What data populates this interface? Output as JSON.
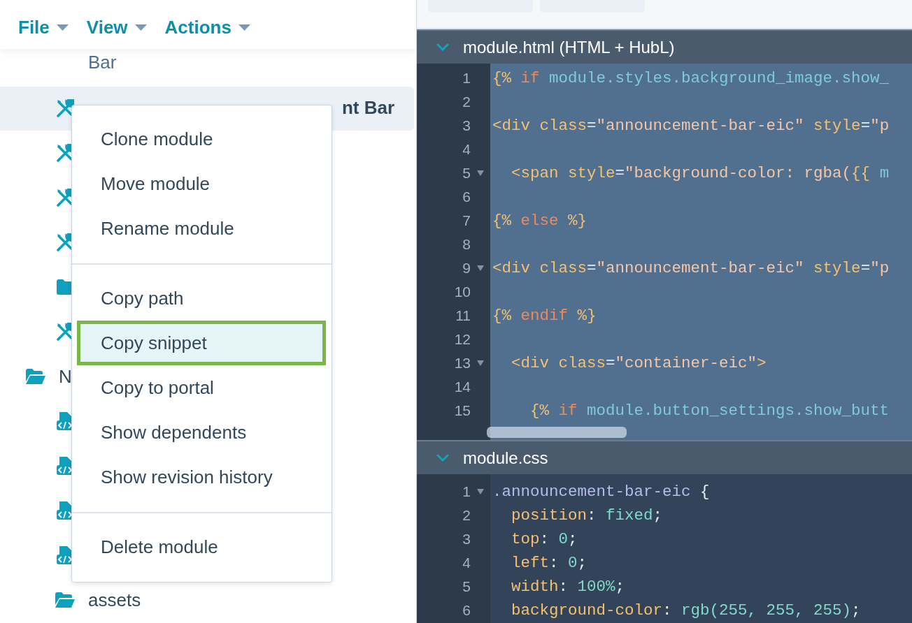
{
  "menu_bar": [
    {
      "label": "File"
    },
    {
      "label": "View"
    },
    {
      "label": "Actions"
    }
  ],
  "tree": {
    "items": [
      {
        "children": [
          {
            "kind": "continuation",
            "label": "Bar",
            "selected": false
          },
          {
            "kind": "module",
            "label": "nt Bar",
            "selected": true
          },
          {
            "kind": "module",
            "selected": false
          },
          {
            "kind": "module",
            "selected": false
          },
          {
            "kind": "module",
            "selected": false
          },
          {
            "kind": "folder",
            "expanded": false,
            "selected": false
          },
          {
            "kind": "module",
            "selected": false
          }
        ]
      },
      {
        "kind": "folder",
        "label": "N",
        "expanded": true,
        "selected": false,
        "children": [
          {
            "kind": "code",
            "selected": false
          },
          {
            "kind": "code",
            "selected": false
          },
          {
            "kind": "code",
            "selected": false
          },
          {
            "kind": "code",
            "selected": false
          },
          {
            "kind": "folder",
            "label": "assets",
            "expanded": true,
            "selected": false
          }
        ]
      }
    ]
  },
  "context_menu": {
    "sections": [
      [
        {
          "label": "Clone module",
          "selected": false
        },
        {
          "label": "Move module",
          "selected": false
        },
        {
          "label": "Rename module",
          "selected": false
        }
      ],
      [
        {
          "label": "Copy path",
          "selected": false
        },
        {
          "label": "Copy snippet",
          "selected": true
        },
        {
          "label": "Copy to portal",
          "selected": false
        },
        {
          "label": "Show dependents",
          "selected": false
        },
        {
          "label": "Show revision history",
          "selected": false
        }
      ],
      [
        {
          "label": "Delete module",
          "selected": false
        }
      ]
    ]
  },
  "editors": [
    {
      "title": "module.html (HTML + HubL)",
      "expanded": true,
      "selected_code": true,
      "lines": [
        {
          "number": "1",
          "foldable": false,
          "tokens": [
            {
              "kind": "delim",
              "text": "{%"
            },
            {
              "kind": "keyword",
              "text": " if"
            },
            {
              "kind": "ident",
              "text": " module.styles.background_image.show_"
            }
          ]
        },
        {
          "number": "2",
          "foldable": false
        },
        {
          "number": "3",
          "foldable": false,
          "tokens": [
            {
              "kind": "tag",
              "text": "<div"
            },
            {
              "kind": "attr",
              "text": " class"
            },
            {
              "kind": "punct",
              "text": "="
            },
            {
              "kind": "string",
              "text": "\"announcement-bar-eic\""
            },
            {
              "kind": "attr",
              "text": " style"
            },
            {
              "kind": "punct",
              "text": "="
            },
            {
              "kind": "string",
              "text": "\"p"
            }
          ]
        },
        {
          "number": "4",
          "foldable": false
        },
        {
          "number": "5",
          "foldable": true,
          "tokens": [
            {
              "kind": "tag",
              "text": "  <span"
            },
            {
              "kind": "attr",
              "text": " style"
            },
            {
              "kind": "punct",
              "text": "="
            },
            {
              "kind": "string",
              "text": "\"background-color: rgba("
            },
            {
              "kind": "delim",
              "text": "{{"
            },
            {
              "kind": "ident",
              "text": " m"
            }
          ]
        },
        {
          "number": "6",
          "foldable": false
        },
        {
          "number": "7",
          "foldable": false,
          "tokens": [
            {
              "kind": "delim",
              "text": "{%"
            },
            {
              "kind": "keyword",
              "text": " else"
            },
            {
              "kind": "delim",
              "text": " %}"
            }
          ]
        },
        {
          "number": "8",
          "foldable": false
        },
        {
          "number": "9",
          "foldable": true,
          "tokens": [
            {
              "kind": "tag",
              "text": "<div"
            },
            {
              "kind": "attr",
              "text": " class"
            },
            {
              "kind": "punct",
              "text": "="
            },
            {
              "kind": "string",
              "text": "\"announcement-bar-eic\""
            },
            {
              "kind": "attr",
              "text": " style"
            },
            {
              "kind": "punct",
              "text": "="
            },
            {
              "kind": "string",
              "text": "\"p"
            }
          ]
        },
        {
          "number": "10",
          "foldable": false
        },
        {
          "number": "11",
          "foldable": false,
          "tokens": [
            {
              "kind": "delim",
              "text": "{%"
            },
            {
              "kind": "keyword",
              "text": " endif"
            },
            {
              "kind": "delim",
              "text": " %}"
            }
          ]
        },
        {
          "number": "12",
          "foldable": false
        },
        {
          "number": "13",
          "foldable": true,
          "tokens": [
            {
              "kind": "tag",
              "text": "  <div"
            },
            {
              "kind": "attr",
              "text": " class"
            },
            {
              "kind": "punct",
              "text": "="
            },
            {
              "kind": "string",
              "text": "\"container-eic\""
            },
            {
              "kind": "tag",
              "text": ">"
            }
          ]
        },
        {
          "number": "14",
          "foldable": false
        },
        {
          "number": "15",
          "foldable": false,
          "tokens": [
            {
              "kind": "delim",
              "text": "    {%"
            },
            {
              "kind": "keyword",
              "text": " if"
            },
            {
              "kind": "ident",
              "text": " module.button_settings.show_butt"
            }
          ]
        }
      ]
    },
    {
      "title": "module.css",
      "expanded": true,
      "selected_code": false,
      "lines": [
        {
          "number": "1",
          "foldable": true,
          "tokens": [
            {
              "kind": "selector",
              "text": ".announcement-bar-eic"
            },
            {
              "kind": "punct",
              "text": " {"
            }
          ]
        },
        {
          "number": "2",
          "foldable": false,
          "tokens": [
            {
              "kind": "property",
              "text": "  position"
            },
            {
              "kind": "punct",
              "text": ": "
            },
            {
              "kind": "value",
              "text": "fixed"
            },
            {
              "kind": "punct",
              "text": ";"
            }
          ]
        },
        {
          "number": "3",
          "foldable": false,
          "tokens": [
            {
              "kind": "property",
              "text": "  top"
            },
            {
              "kind": "punct",
              "text": ": "
            },
            {
              "kind": "value",
              "text": "0"
            },
            {
              "kind": "punct",
              "text": ";"
            }
          ]
        },
        {
          "number": "4",
          "foldable": false,
          "tokens": [
            {
              "kind": "property",
              "text": "  left"
            },
            {
              "kind": "punct",
              "text": ": "
            },
            {
              "kind": "value",
              "text": "0"
            },
            {
              "kind": "punct",
              "text": ";"
            }
          ]
        },
        {
          "number": "5",
          "foldable": false,
          "tokens": [
            {
              "kind": "property",
              "text": "  width"
            },
            {
              "kind": "punct",
              "text": ": "
            },
            {
              "kind": "value",
              "text": "100%"
            },
            {
              "kind": "punct",
              "text": ";"
            }
          ]
        },
        {
          "number": "6",
          "foldable": false,
          "tokens": [
            {
              "kind": "property",
              "text": "  background-color"
            },
            {
              "kind": "punct",
              "text": ": "
            },
            {
              "kind": "value",
              "text": "rgb(255, 255, 255)"
            },
            {
              "kind": "punct",
              "text": ";"
            }
          ]
        }
      ]
    }
  ]
}
